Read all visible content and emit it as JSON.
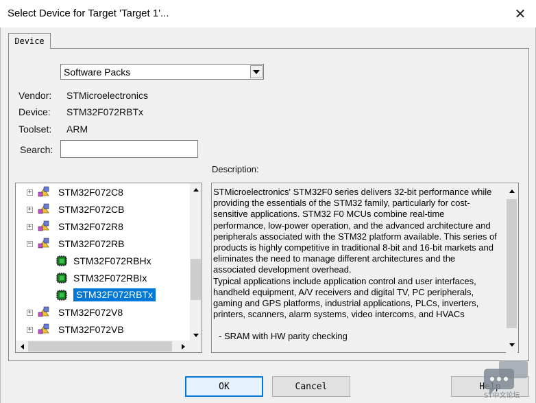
{
  "window": {
    "title": "Select Device for Target 'Target 1'...",
    "close_glyph": "✕"
  },
  "tab": {
    "label": "Device"
  },
  "source_select": {
    "value": "Software Packs"
  },
  "info": {
    "vendor_label": "Vendor:",
    "vendor_value": "STMicroelectronics",
    "device_label": "Device:",
    "device_value": "STM32F072RBTx",
    "toolset_label": "Toolset:",
    "toolset_value": "ARM",
    "search_label": "Search:",
    "search_value": ""
  },
  "tree": {
    "items": [
      {
        "label": "STM32F072C8",
        "level": 0,
        "expander": "+",
        "icon": "chip-family-icon"
      },
      {
        "label": "STM32F072CB",
        "level": 0,
        "expander": "+",
        "icon": "chip-family-icon"
      },
      {
        "label": "STM32F072R8",
        "level": 0,
        "expander": "+",
        "icon": "chip-family-icon"
      },
      {
        "label": "STM32F072RB",
        "level": 0,
        "expander": "−",
        "icon": "chip-family-icon"
      },
      {
        "label": "STM32F072RBHx",
        "level": 1,
        "expander": "",
        "icon": "chip-icon"
      },
      {
        "label": "STM32F072RBIx",
        "level": 1,
        "expander": "",
        "icon": "chip-icon"
      },
      {
        "label": "STM32F072RBTx",
        "level": 1,
        "expander": "",
        "icon": "chip-icon",
        "selected": true
      },
      {
        "label": "STM32F072V8",
        "level": 0,
        "expander": "+",
        "icon": "chip-family-icon"
      },
      {
        "label": "STM32F072VB",
        "level": 0,
        "expander": "+",
        "icon": "chip-family-icon"
      }
    ]
  },
  "description": {
    "label": "Description:",
    "text": "STMicroelectronics' STM32F0 series delivers 32-bit performance while\nproviding the essentials of the STM32 family, particularly for cost-\nsensitive applications. STM32 F0 MCUs combine real-time\nperformance, low-power operation, and the advanced architecture and\nperipherals associated with the STM32 platform available. This series of\nproducts is highly competitive in traditional 8-bit and 16-bit markets and\neliminates the need to manage different architectures and the\nassociated development overhead.\nTypical applications include application control and user interfaces,\nhandheld equipment, A/V receivers and digital TV, PC peripherals,\ngaming and GPS platforms, industrial applications, PLCs, inverters,\nprinters, scanners, alarm systems, video intercoms, and HVACs",
    "bullet": "- SRAM with HW parity checking"
  },
  "buttons": {
    "ok": "OK",
    "cancel": "Cancel",
    "help": "Help"
  },
  "watermark": {
    "text": "ST中文论坛"
  },
  "colors": {
    "selection": "#0078d7",
    "window_bg": "#f0f0f0"
  }
}
